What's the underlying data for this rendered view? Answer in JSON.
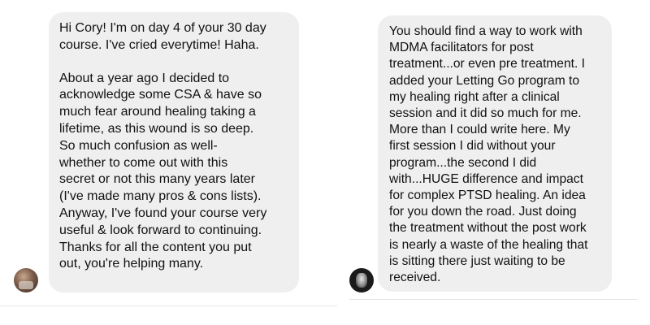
{
  "conversations": [
    {
      "message": {
        "paragraphs": [
          "Hi Cory! I'm on day 4 of your 30 day\ncourse. I've cried everytime! Haha.",
          "About a year ago I decided to\nacknowledge some CSA & have so\nmuch fear around healing taking a\nlifetime, as this wound is so deep.\nSo much confusion as well-\nwhether to come out with this\nsecret or not this many years later\n(I've made many pros & cons lists).\nAnyway, I've found your course very\nuseful & look forward to continuing.\nThanks for all the content you put\nout, you're helping many."
        ]
      }
    },
    {
      "message": {
        "paragraphs": [
          "You should find a way to work with\nMDMA facilitators for post\ntreatment...or even pre treatment. I\nadded your Letting Go program to\nmy healing right after a clinical\nsession and it did so much for me.\nMore than I could write here. My\nfirst session I did without your\nprogram...the second I did\nwith...HUGE difference and impact\nfor complex PTSD healing. An idea\nfor you down the road. Just doing\nthe treatment without the post work\nis nearly a waste of the healing that\nis sitting there just waiting to be\nreceived."
        ]
      }
    }
  ],
  "theme": {
    "bubble_background": "#efefef",
    "text_color": "#111111",
    "page_background": "#ffffff"
  }
}
